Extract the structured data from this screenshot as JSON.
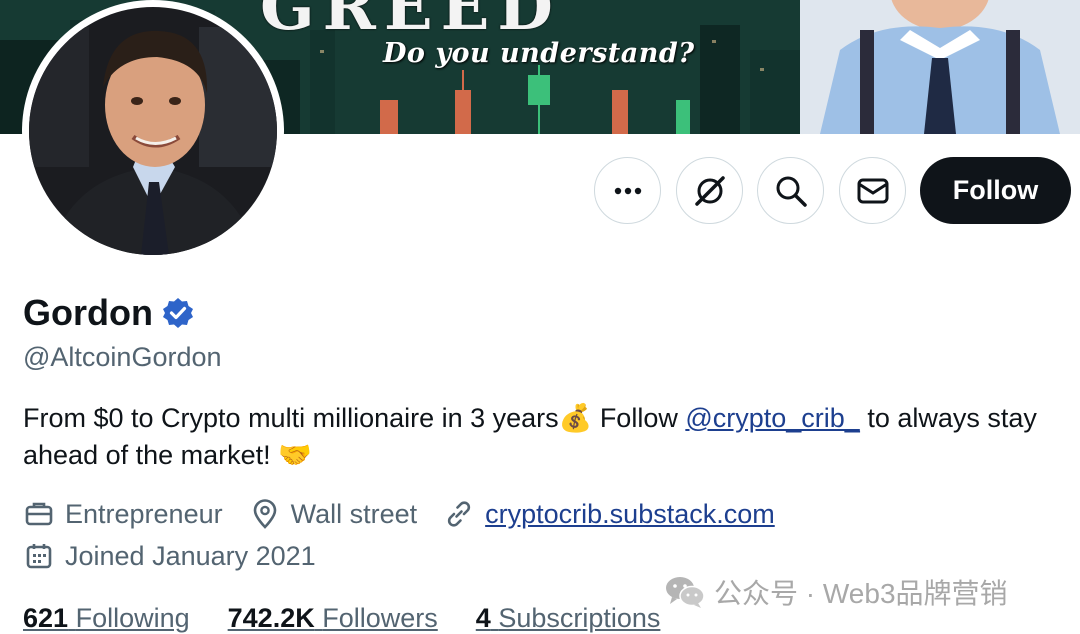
{
  "banner": {
    "headline": "GREED",
    "tagline": "Do you understand?"
  },
  "profile": {
    "name": "Gordon",
    "handle": "@AltcoinGordon",
    "verified": true,
    "verified_color": "#2e64c9"
  },
  "actions": {
    "more_icon": "more-icon",
    "grok_icon": "grok-icon",
    "search_icon": "search-icon",
    "message_icon": "message-icon",
    "follow_label": "Follow"
  },
  "bio": {
    "part1": "From $0 to Crypto multi millionaire in 3 years",
    "emoji_money": "💰",
    "part2": " Follow ",
    "mention": "@crypto_crib_",
    "part3": " to always stay ahead of the market! ",
    "emoji_handshake": "🤝"
  },
  "meta": {
    "profession": "Entrepreneur",
    "location": "Wall street",
    "website": "cryptocrib.substack.com",
    "joined": "Joined January 2021"
  },
  "stats": {
    "following_count": "621",
    "following_label": "Following",
    "followers_count": "742.2K",
    "followers_label": "Followers",
    "subscriptions_count": "4",
    "subscriptions_label": "Subscriptions"
  },
  "watermark": {
    "text": "公众号 · Web3品牌营销"
  },
  "colors": {
    "accent": "#0f1419",
    "link": "#1d3f8f",
    "muted": "#536471"
  }
}
